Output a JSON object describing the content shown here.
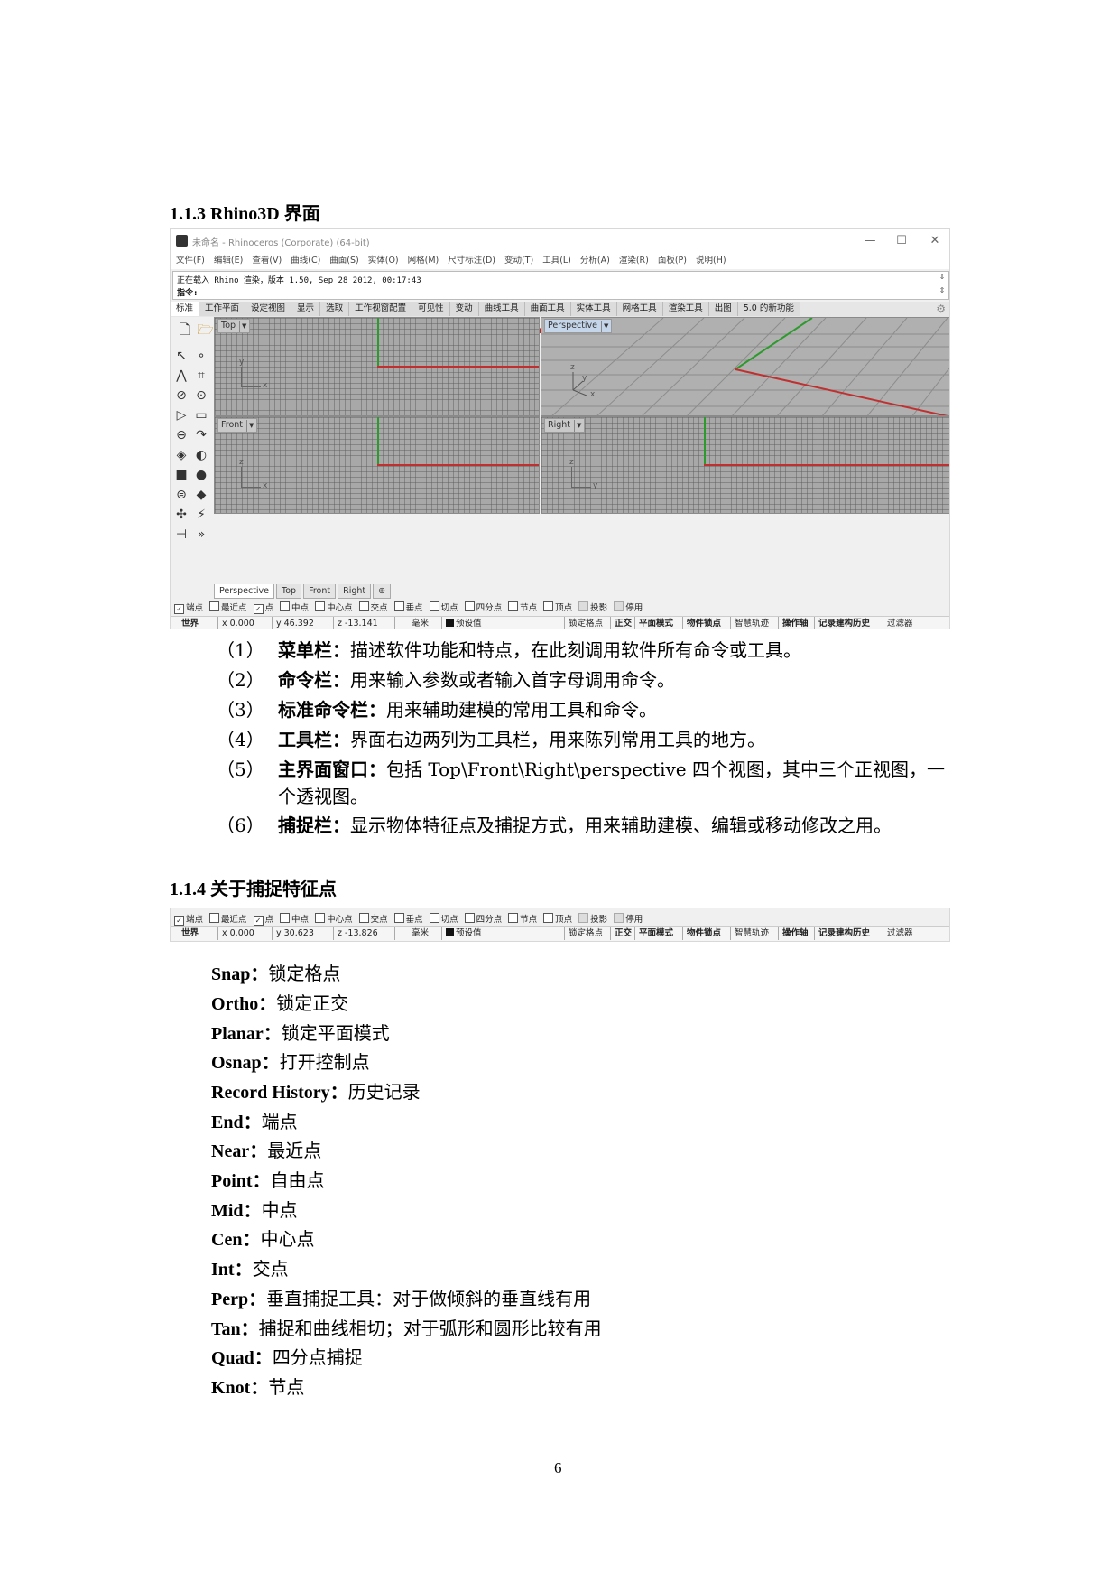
{
  "section1": {
    "title": "1.1.3 Rhino3D 界面"
  },
  "rhino": {
    "window_title": "未命名 - Rhinoceros (Corporate) (64-bit)",
    "window_buttons": [
      "—",
      "☐",
      "✕"
    ],
    "menu": [
      "文件(F)",
      "编辑(E)",
      "查看(V)",
      "曲线(C)",
      "曲面(S)",
      "实体(O)",
      "网格(M)",
      "尺寸标注(D)",
      "变动(T)",
      "工具(L)",
      "分析(A)",
      "渲染(R)",
      "面板(P)",
      "说明(H)"
    ],
    "command_history": "正在载入 Rhino 渲染，版本 1.50, Sep 28 2012, 00:17:43",
    "command_prompt": "指令:",
    "toolbar_tabs": [
      "标准",
      "工作平面",
      "设定视图",
      "显示",
      "选取",
      "工作视窗配置",
      "可见性",
      "变动",
      "曲线工具",
      "曲面工具",
      "实体工具",
      "网格工具",
      "渲染工具",
      "出图",
      "5.0 的新功能"
    ],
    "viewports": {
      "top": "Top",
      "perspective": "Perspective",
      "front": "Front",
      "right": "Right"
    },
    "axis_letters": {
      "x": "x",
      "y": "y",
      "z": "z"
    },
    "viewport_tabs": [
      "Perspective",
      "Top",
      "Front",
      "Right",
      "⊕"
    ],
    "osnaps": [
      {
        "label": "端点",
        "checked": true
      },
      {
        "label": "最近点",
        "checked": false
      },
      {
        "label": "点",
        "checked": true
      },
      {
        "label": "中点",
        "checked": false
      },
      {
        "label": "中心点",
        "checked": false
      },
      {
        "label": "交点",
        "checked": false
      },
      {
        "label": "垂点",
        "checked": false
      },
      {
        "label": "切点",
        "checked": false
      },
      {
        "label": "四分点",
        "checked": false
      },
      {
        "label": "节点",
        "checked": false
      },
      {
        "label": "顶点",
        "checked": false
      },
      {
        "label": "投影",
        "checked": false
      },
      {
        "label": "停用",
        "checked": false
      }
    ],
    "status": {
      "cplane": "世界",
      "x": "x 0.000",
      "y": "y 46.392",
      "z": "z -13.141",
      "units": "毫米",
      "layer": "预设值",
      "toggles": [
        "锁定格点",
        "正交",
        "平面模式",
        "物件锁点",
        "智慧轨迹",
        "操作轴",
        "记录建构历史",
        "过滤器"
      ]
    }
  },
  "list1": [
    {
      "num": "（1）",
      "term": "菜单栏：",
      "text": "描述软件功能和特点，在此刻调用软件所有命令或工具。"
    },
    {
      "num": "（2）",
      "term": "命令栏：",
      "text": "用来输入参数或者输入首字母调用命令。"
    },
    {
      "num": "（3）",
      "term": "标准命令栏：",
      "text": "用来辅助建模的常用工具和命令。"
    },
    {
      "num": "（4）",
      "term": "工具栏：",
      "text": "界面右边两列为工具栏，用来陈列常用工具的地方。"
    },
    {
      "num": "（5）",
      "term": "主界面窗口：",
      "text": "包括 Top\\Front\\Right\\perspective 四个视图，其中三个正视图，一",
      "cont": "个透视图。"
    },
    {
      "num": "（6）",
      "term": "捕捉栏：",
      "text": "显示物体特征点及捕捉方式，用来辅助建模、编辑或移动修改之用。"
    }
  ],
  "section2": {
    "title": "1.1.4  关于捕捉特征点"
  },
  "strip2": {
    "osnaps": [
      {
        "label": "端点",
        "checked": true
      },
      {
        "label": "最近点",
        "checked": false
      },
      {
        "label": "点",
        "checked": true
      },
      {
        "label": "中点",
        "checked": false
      },
      {
        "label": "中心点",
        "checked": false
      },
      {
        "label": "交点",
        "checked": false
      },
      {
        "label": "垂点",
        "checked": false
      },
      {
        "label": "切点",
        "checked": false
      },
      {
        "label": "四分点",
        "checked": false
      },
      {
        "label": "节点",
        "checked": false
      },
      {
        "label": "顶点",
        "checked": false
      },
      {
        "label": "投影",
        "checked": false
      },
      {
        "label": "停用",
        "checked": false
      }
    ],
    "status": {
      "cplane": "世界",
      "x": "x 0.000",
      "y": "y 30.623",
      "z": "z -13.826",
      "units": "毫米",
      "layer": "预设值",
      "toggles": [
        "锁定格点",
        "正交",
        "平面模式",
        "物件锁点",
        "智慧轨迹",
        "操作轴",
        "记录建构历史",
        "过滤器"
      ]
    }
  },
  "definitions": [
    {
      "term": "Snap：",
      "text": "锁定格点"
    },
    {
      "term": "Ortho：",
      "text": "锁定正交"
    },
    {
      "term": "Planar：",
      "text": "锁定平面模式"
    },
    {
      "term": "Osnap：",
      "text": "打开控制点"
    },
    {
      "term": "Record History：",
      "text": "历史记录"
    },
    {
      "term": "End：",
      "text": "端点"
    },
    {
      "term": "Near：",
      "text": "最近点"
    },
    {
      "term": "Point：",
      "text": "自由点"
    },
    {
      "term": "Mid：",
      "text": "中点"
    },
    {
      "term": "Cen：",
      "text": "中心点"
    },
    {
      "term": "Int：",
      "text": "交点"
    },
    {
      "term": "Perp：",
      "text": "垂直捕捉工具：对于做倾斜的垂直线有用"
    },
    {
      "term": "Tan：",
      "text": "捕捉和曲线相切；对于弧形和圆形比较有用"
    },
    {
      "term": "Quad：",
      "text": "四分点捕捉"
    },
    {
      "term": "Knot：",
      "text": "节点"
    }
  ],
  "page_number": "6"
}
